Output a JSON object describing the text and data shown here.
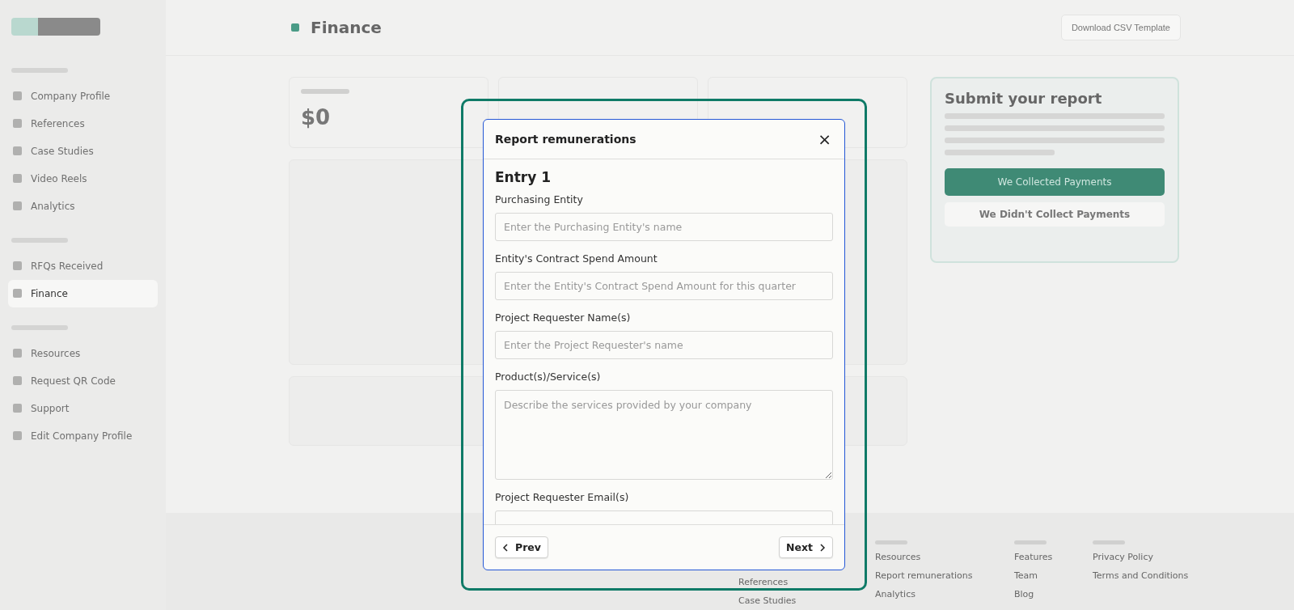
{
  "sidebar": {
    "sections": [
      {
        "items": [
          {
            "label": "Company Profile",
            "selected": false
          },
          {
            "label": "References",
            "selected": false
          },
          {
            "label": "Case Studies",
            "selected": false
          },
          {
            "label": "Video Reels",
            "selected": false
          },
          {
            "label": "Analytics",
            "selected": false
          }
        ]
      },
      {
        "items": [
          {
            "label": "RFQs Received",
            "selected": false
          },
          {
            "label": "Finance",
            "selected": true
          }
        ]
      },
      {
        "items": [
          {
            "label": "Resources",
            "selected": false
          },
          {
            "label": "Request QR Code",
            "selected": false
          },
          {
            "label": "Support",
            "selected": false
          },
          {
            "label": "Edit Company Profile",
            "selected": false
          }
        ]
      }
    ]
  },
  "header": {
    "title": "Finance",
    "button": "Download CSV Template"
  },
  "stat": {
    "value": "$0"
  },
  "report_card": {
    "title": "Submit your report",
    "primary_button": "We Collected Payments",
    "secondary_button": "We Didn't Collect Payments"
  },
  "footer": {
    "columns": [
      {
        "links": [
          "References",
          "Case Studies"
        ]
      },
      {
        "links": [
          "Resources",
          "Report remunerations",
          "Analytics"
        ]
      },
      {
        "links": [
          "Features",
          "Team",
          "Blog"
        ]
      },
      {
        "links": [
          "Privacy Policy",
          "Terms and Conditions"
        ]
      }
    ]
  },
  "modal": {
    "title": "Report remunerations",
    "close": "×",
    "entry_title": "Entry 1",
    "fields": [
      {
        "kind": "input",
        "label": "Purchasing Entity",
        "placeholder": "Enter the Purchasing Entity's name"
      },
      {
        "kind": "input",
        "label": "Entity's Contract Spend Amount",
        "placeholder": "Enter the Entity's Contract Spend Amount for this quarter"
      },
      {
        "kind": "input",
        "label": "Project Requester Name(s)",
        "placeholder": "Enter the Project Requester's name"
      },
      {
        "kind": "textarea",
        "label": "Product(s)/Service(s)",
        "placeholder": "Describe the services provided by your company"
      },
      {
        "kind": "input",
        "label": "Project Requester Email(s)"
      }
    ],
    "prev": "Prev",
    "next": "Next"
  }
}
